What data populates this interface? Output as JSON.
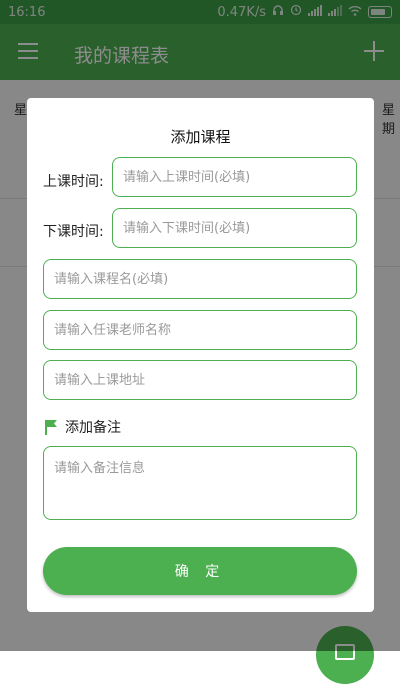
{
  "status_bar": {
    "time": "16:16",
    "network_speed": "0.47K/s"
  },
  "app_bar": {
    "title": "我的课程表"
  },
  "background": {
    "weekday_left": "星",
    "weekday_right": "星期",
    "row_label": ""
  },
  "dialog": {
    "title": "添加课程",
    "start_time_label": "上课时间:",
    "start_time_placeholder": "请输入上课时间(必填)",
    "end_time_label": "下课时间:",
    "end_time_placeholder": "请输入下课时间(必填)",
    "course_name_placeholder": "请输入课程名(必填)",
    "teacher_placeholder": "请输入任课老师名称",
    "location_placeholder": "请输入上课地址",
    "note_label": "添加备注",
    "note_placeholder": "请输入备注信息",
    "confirm_label": "确 定"
  },
  "colors": {
    "accent": "#4caf50",
    "status_bar": "#3d9f47",
    "scrim": "rgba(0,0,0,0.45)"
  },
  "icons": [
    "menu-icon",
    "add-icon",
    "flag-icon",
    "wifi-icon",
    "signal-icon",
    "battery-icon",
    "headphone-icon",
    "alarm-icon"
  ]
}
